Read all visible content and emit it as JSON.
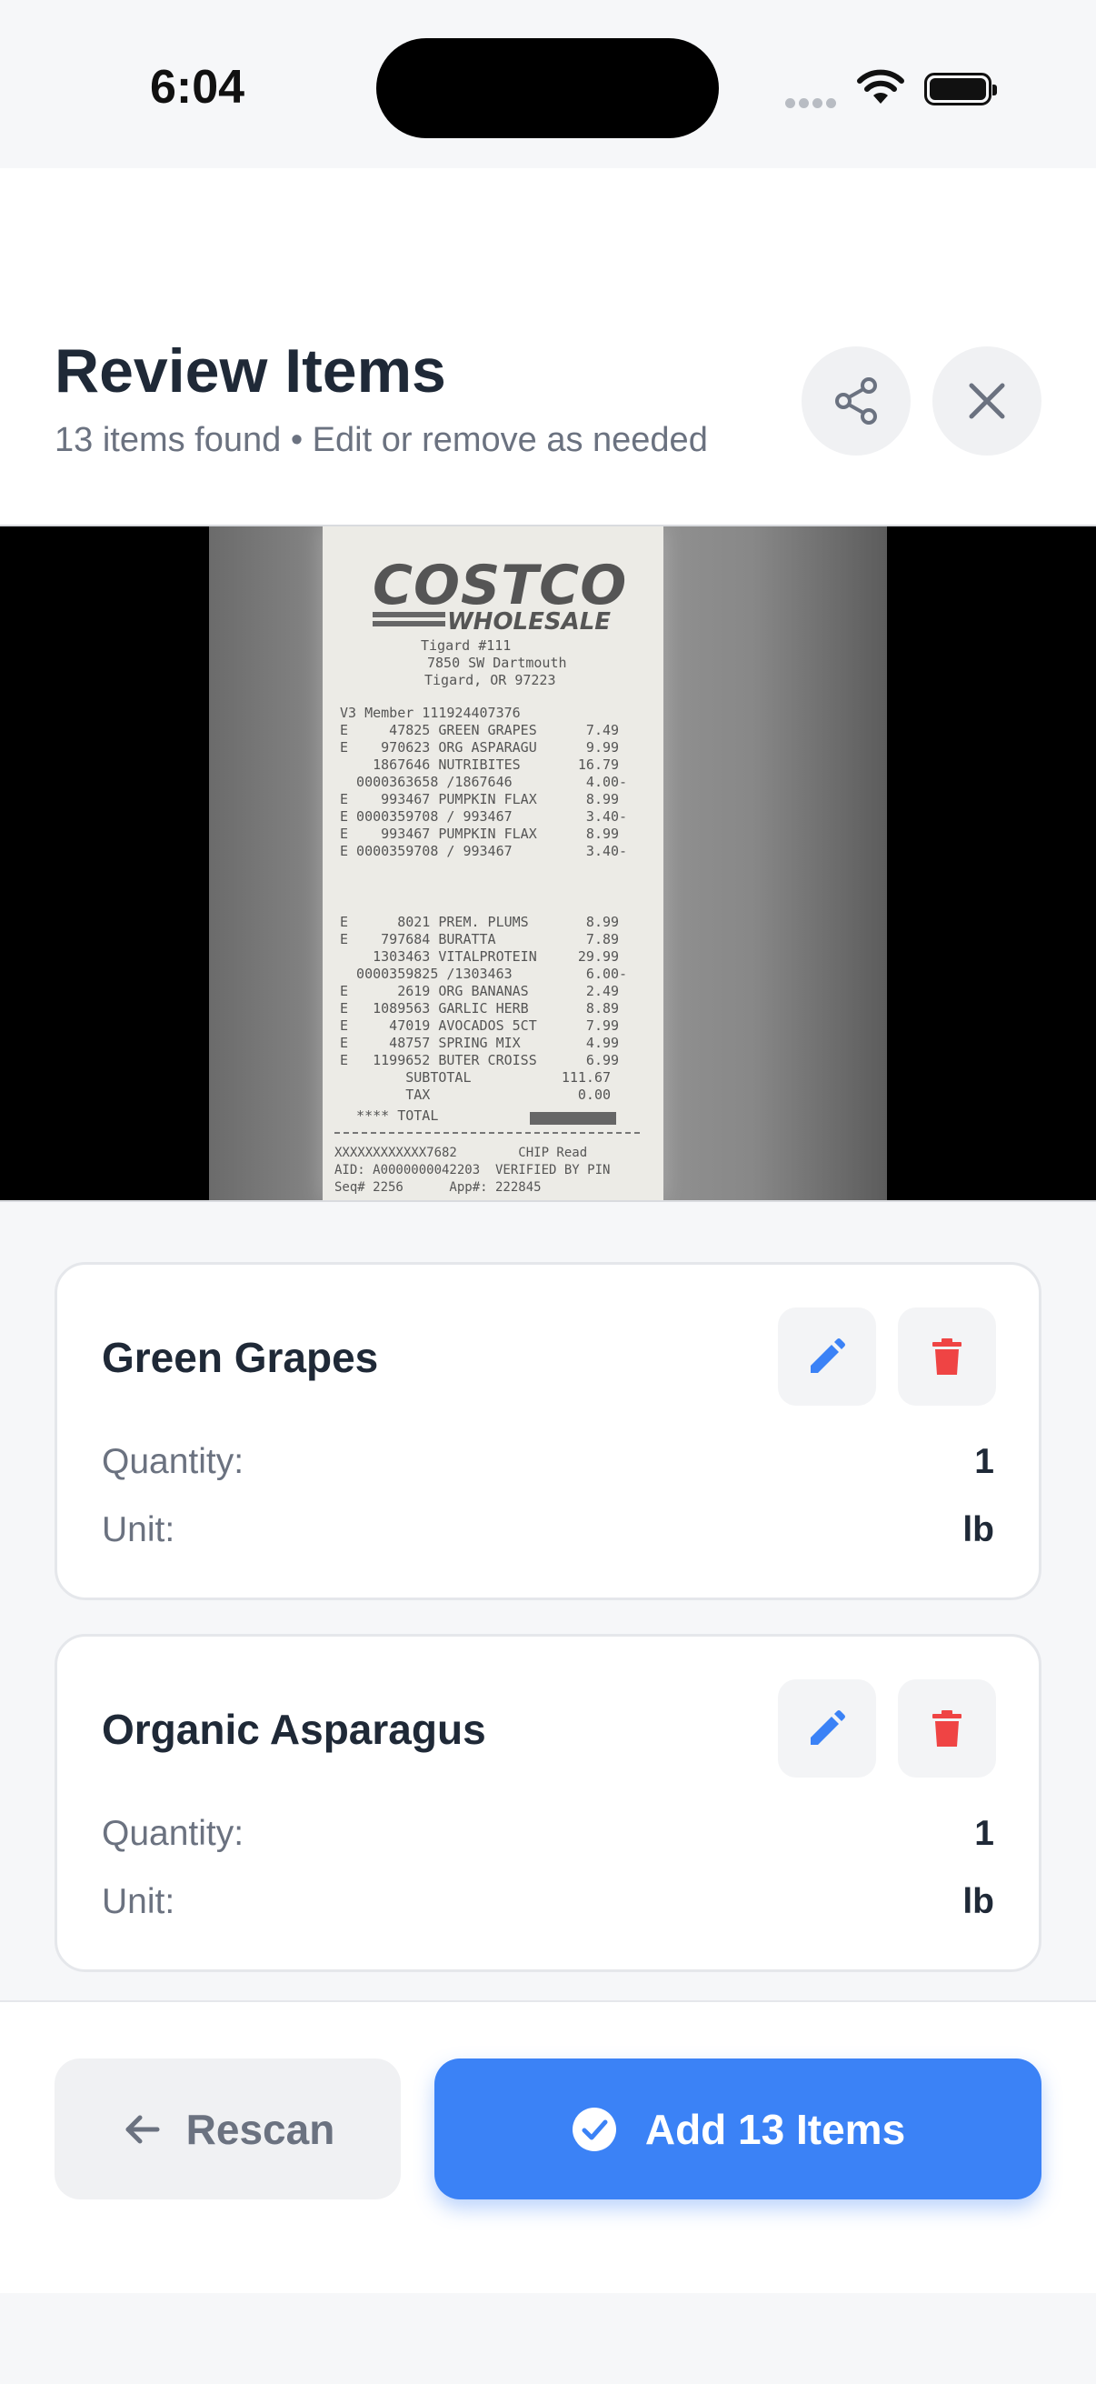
{
  "status_bar": {
    "time": "6:04"
  },
  "header": {
    "title": "Review Items",
    "subtitle": "13 items found • Edit or remove as needed"
  },
  "receipt_text": {
    "logo": "COSTCO",
    "logo_sub": "WHOLESALE",
    "lines": [
      "Tigard #111",
      "7850 SW Dartmouth",
      "Tigard, OR 97223",
      "V3 Member 111924407376",
      "E     47825 GREEN GRAPES      7.49",
      "E    970623 ORG ASPARAGU      9.99",
      "    1867646 NUTRIBITES       16.79",
      "  0000363658 /1867646         4.00-",
      "E    993467 PUMPKIN FLAX      8.99",
      "E 0000359708 / 993467         3.40-",
      "E    993467 PUMPKIN FLAX      8.99",
      "E 0000359708 / 993467         3.40-",
      "E      8021 PREM. PLUMS       8.99",
      "E    797684 BURATTA           7.89",
      "    1303463 VITALPROTEIN     29.99",
      "  0000359825 /1303463         6.00-",
      "E      2619 ORG BANANAS       2.49",
      "E   1089563 GARLIC HERB       8.89",
      "E     47019 AVOCADOS 5CT      7.99",
      "E     48757 SPRING MIX        4.99",
      "E   1199652 BUTER CROISS      6.99",
      "        SUBTOTAL           111.67",
      "        TAX                  0.00",
      "  **** TOTAL",
      "XXXXXXXXXXXX7682        CHIP Read",
      "AID: A0000000042203  VERIFIED BY PIN",
      "Seq# 2256      App#: 222845"
    ]
  },
  "items": [
    {
      "name": "Green Grapes",
      "quantity_label": "Quantity:",
      "quantity": "1",
      "unit_label": "Unit:",
      "unit": "lb"
    },
    {
      "name": "Organic Asparagus",
      "quantity_label": "Quantity:",
      "quantity": "1",
      "unit_label": "Unit:",
      "unit": "lb"
    }
  ],
  "footer": {
    "rescan_label": "Rescan",
    "add_label": "Add 13 Items"
  },
  "colors": {
    "primary": "#3b82f6",
    "danger": "#ef4444",
    "text": "#1f2937",
    "muted": "#6b7280"
  },
  "icons": [
    "share-icon",
    "close-icon",
    "edit-icon",
    "trash-icon",
    "arrow-left-icon",
    "check-circle-icon"
  ]
}
